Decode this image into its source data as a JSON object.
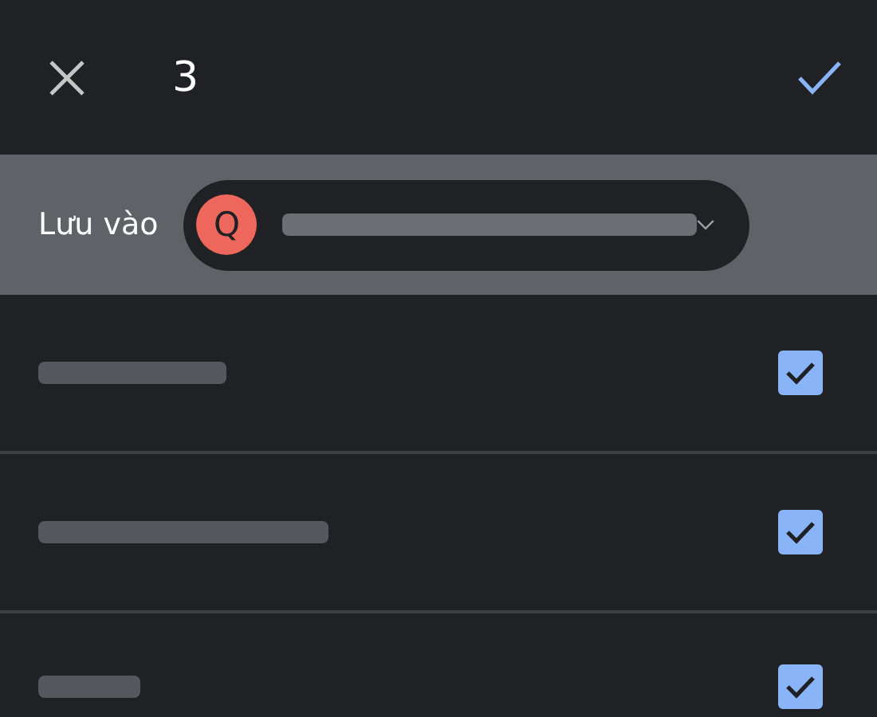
{
  "header": {
    "count": "3"
  },
  "save_to": {
    "label": "Lưu vào",
    "avatar_letter": "Q",
    "redacted": true
  },
  "items": [
    {
      "checked": true,
      "redacted": true
    },
    {
      "checked": true,
      "redacted": true
    },
    {
      "checked": true,
      "redacted": true
    }
  ]
}
